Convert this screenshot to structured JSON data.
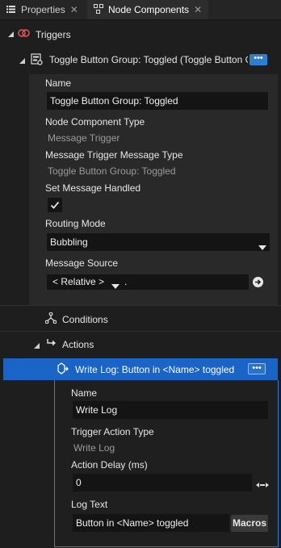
{
  "tabs": [
    {
      "label": "Properties",
      "close": "✕"
    },
    {
      "label": "Node Components",
      "close": "✕"
    }
  ],
  "tree": {
    "triggers_label": "Triggers",
    "trigger_title": "Toggle Button Group: Toggled (Toggle Button G",
    "conditions_label": "Conditions",
    "actions_label": "Actions",
    "action_title": "Write Log: Button in <Name> toggled"
  },
  "trigger": {
    "name_label": "Name",
    "name_value": "Toggle Button Group: Toggled",
    "component_type_label": "Node Component Type",
    "component_type_value": "Message Trigger",
    "message_type_label": "Message Trigger Message Type",
    "message_type_value": "Toggle Button Group: Toggled",
    "handled_label": "Set Message Handled",
    "handled_checked": true,
    "routing_label": "Routing Mode",
    "routing_value": "Bubbling",
    "source_label": "Message Source",
    "source_value": "< Relative >",
    "source_path": "."
  },
  "action": {
    "name_label": "Name",
    "name_value": "Write Log",
    "type_label": "Trigger Action Type",
    "type_value": "Write Log",
    "delay_label": "Action Delay (ms)",
    "delay_value": "0",
    "logtext_label": "Log Text",
    "logtext_value": "Button in <Name> toggled",
    "macros_label": "Macros"
  },
  "colors": {
    "accent": "#1a64c8",
    "background": "#1e1e1e",
    "panel": "#292929"
  },
  "icons": [
    "list-icon",
    "node-component-icon",
    "triggers-icon",
    "trigger-node-icon",
    "conditions-icon",
    "actions-icon",
    "write-log-icon",
    "more-icon",
    "checkmark-icon",
    "dropdown-arrow-icon",
    "reset-icon",
    "drag-arrows-icon"
  ]
}
